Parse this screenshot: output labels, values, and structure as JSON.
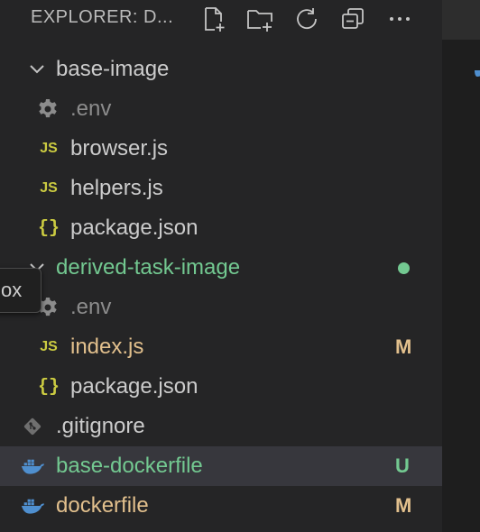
{
  "explorer": {
    "title": "EXPLORER: D...",
    "toolbar": {
      "new_file_icon": "new-file-icon",
      "new_folder_icon": "new-folder-icon",
      "refresh_icon": "refresh-icon",
      "collapse_icon": "collapse-all-icon",
      "more_icon": "more-actions-icon"
    }
  },
  "tree": {
    "base_image": {
      "label": "base-image",
      "items": [
        {
          "label": ".env",
          "icon": "gear-icon"
        },
        {
          "label": "browser.js",
          "icon": "js-icon",
          "icon_text": "JS"
        },
        {
          "label": "helpers.js",
          "icon": "js-icon",
          "icon_text": "JS"
        },
        {
          "label": "package.json",
          "icon": "json-icon",
          "icon_text": "{}"
        }
      ]
    },
    "derived_task_image": {
      "label": "derived-task-image",
      "status_color": "#73c991",
      "items": [
        {
          "label": ".env",
          "icon": "gear-icon"
        },
        {
          "label": "index.js",
          "icon": "js-icon",
          "icon_text": "JS",
          "badge": "M"
        },
        {
          "label": "package.json",
          "icon": "json-icon",
          "icon_text": "{}"
        }
      ]
    },
    "root_files": [
      {
        "label": ".gitignore",
        "icon": "git-icon"
      },
      {
        "label": "base-dockerfile",
        "icon": "docker-icon",
        "badge": "U"
      },
      {
        "label": "dockerfile",
        "icon": "docker-icon",
        "badge": "M"
      }
    ]
  },
  "tooltip": {
    "text": "ox"
  },
  "colors": {
    "modified": "#e2c08d",
    "untracked": "#73c991",
    "default_text": "#cccccc",
    "env_text": "#8c8c8c",
    "docker_blue": "#4f8fcf",
    "js_yellow": "#cbcb41"
  }
}
